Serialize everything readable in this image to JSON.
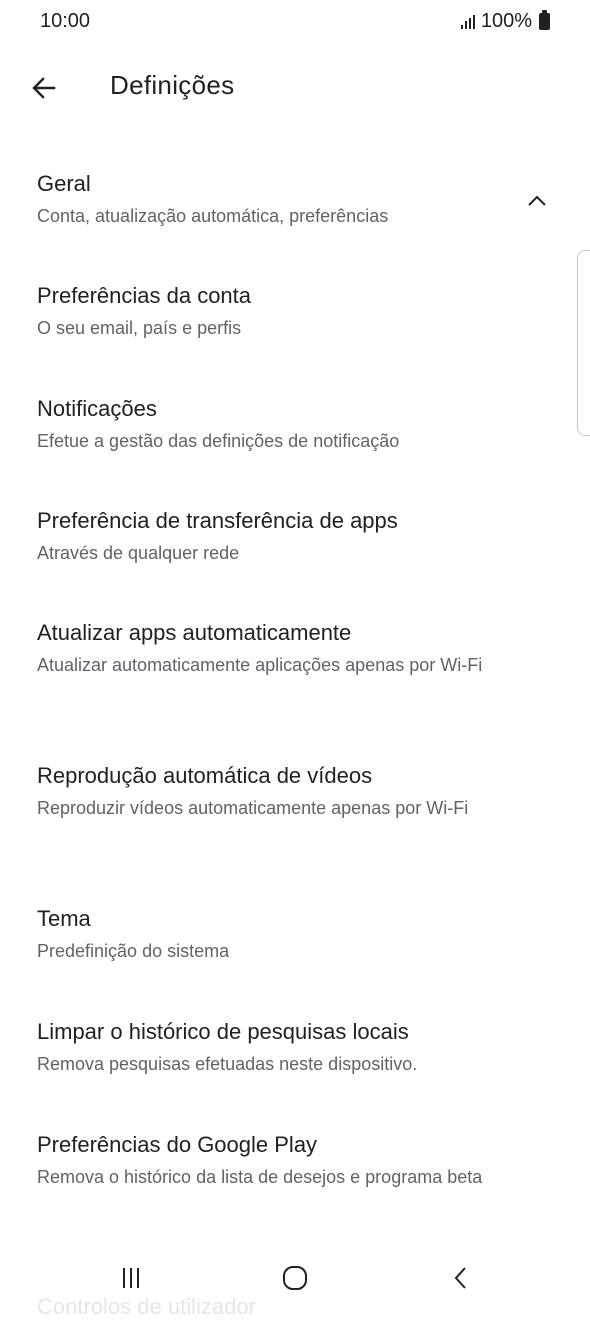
{
  "status_bar": {
    "time": "10:00",
    "battery": "100%"
  },
  "header": {
    "title": "Definições"
  },
  "sections": [
    {
      "title": "Geral",
      "subtitle": "Conta, atualização automática, preferências",
      "expanded": true
    },
    {
      "title": "Preferências da conta",
      "subtitle": "O seu email, país e perfis"
    },
    {
      "title": "Notificações",
      "subtitle": "Efetue a gestão das definições de notificação"
    },
    {
      "title": "Preferência de transferência de apps",
      "subtitle": "Através de qualquer rede"
    },
    {
      "title": "Atualizar apps automaticamente",
      "subtitle": "Atualizar automaticamente aplicações apenas por Wi-Fi"
    },
    {
      "title": "Reprodução automática de vídeos",
      "subtitle": "Reproduzir vídeos automaticamente apenas por Wi-Fi"
    },
    {
      "title": "Tema",
      "subtitle": "Predefinição do sistema"
    },
    {
      "title": "Limpar o histórico de pesquisas locais",
      "subtitle": "Remova pesquisas efetuadas neste dispositivo."
    },
    {
      "title": "Preferências do Google Play",
      "subtitle": "Remova o histórico da lista de desejos e programa beta"
    },
    {
      "title": "Controlos de utilizador"
    }
  ],
  "icons": {
    "back": "arrow-left-icon",
    "collapse": "chevron-up-icon",
    "nav_recents": "recents-icon",
    "nav_home": "home-icon",
    "nav_back": "chevron-left-icon"
  }
}
